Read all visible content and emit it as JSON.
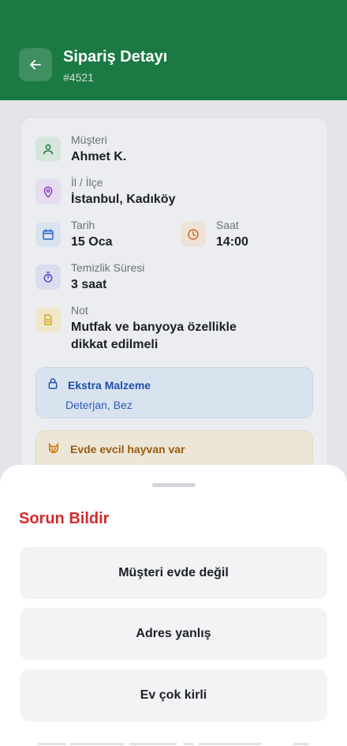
{
  "header": {
    "title": "Sipariş Detayı",
    "order_id": "#4521"
  },
  "details": {
    "customer": {
      "label": "Müşteri",
      "value": "Ahmet K."
    },
    "location": {
      "label": "İl / İlçe",
      "value": "İstanbul, Kadıköy"
    },
    "date": {
      "label": "Tarih",
      "value": "15 Oca"
    },
    "time": {
      "label": "Saat",
      "value": "14:00"
    },
    "duration": {
      "label": "Temizlik Süresi",
      "value": "3 saat"
    },
    "note": {
      "label": "Not",
      "value": "Mutfak ve banyoya özellikle dikkat edilmeli"
    }
  },
  "extra_materials": {
    "title": "Ekstra Malzeme",
    "items": "Deterjan, Bez"
  },
  "pet_notice": "Evde evcil hayvan var",
  "sheet": {
    "title": "Sorun Bildir",
    "options": [
      "Müşteri evde değil",
      "Adres yanlış",
      "Ev çok kirli"
    ]
  },
  "colors": {
    "header_bg": "#1b7a43",
    "danger": "#d12b2b",
    "info": "#1e4fa8",
    "warning": "#9a5a10"
  },
  "icons": {
    "back": "arrow-left-icon",
    "customer": "user-icon",
    "location": "map-pin-icon",
    "date": "calendar-icon",
    "time": "clock-icon",
    "duration": "timer-icon",
    "note": "note-icon",
    "extra": "lock-icon",
    "pet": "pet-icon"
  }
}
